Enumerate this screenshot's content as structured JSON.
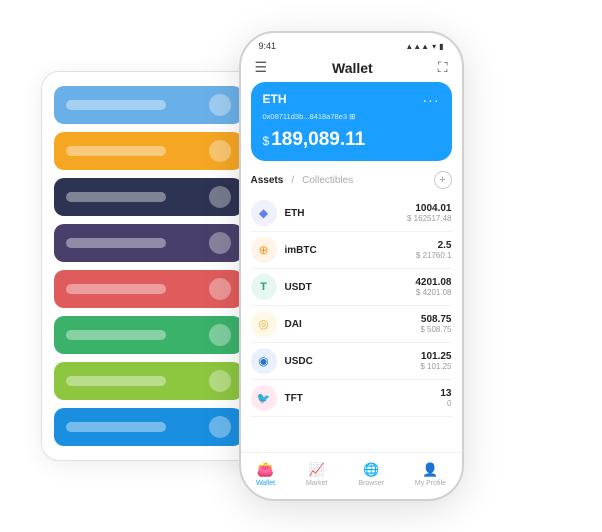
{
  "bg_card": {
    "rows": [
      {
        "color": "#6ab0e8",
        "text_opacity": 0.4
      },
      {
        "color": "#f5a623",
        "text_opacity": 0.4
      },
      {
        "color": "#2d3352",
        "text_opacity": 0.4
      },
      {
        "color": "#4a3f6b",
        "text_opacity": 0.4
      },
      {
        "color": "#e05c5c",
        "text_opacity": 0.4
      },
      {
        "color": "#3ab26a",
        "text_opacity": 0.4
      },
      {
        "color": "#8dc63f",
        "text_opacity": 0.4
      },
      {
        "color": "#1a8fe0",
        "text_opacity": 0.4
      }
    ]
  },
  "phone": {
    "status_bar": {
      "time": "9:41",
      "signal": "▲▲▲",
      "wifi": "WiFi",
      "battery": "🔋"
    },
    "header": {
      "menu_icon": "☰",
      "title": "Wallet",
      "expand_icon": "⛶"
    },
    "eth_card": {
      "label": "ETH",
      "dots": "···",
      "address": "0x08711d3b...8418a78e3  ⊞",
      "currency_symbol": "$",
      "amount": "189,089.11"
    },
    "assets_section": {
      "tab_active": "Assets",
      "separator": "/",
      "tab_inactive": "Collectibles",
      "add_icon": "+"
    },
    "assets": [
      {
        "name": "ETH",
        "icon": "◆",
        "icon_color": "#627EEA",
        "amount": "1004.01",
        "usd": "$ 162517.48"
      },
      {
        "name": "imBTC",
        "icon": "⊕",
        "icon_color": "#F7931A",
        "amount": "2.5",
        "usd": "$ 21760.1"
      },
      {
        "name": "USDT",
        "icon": "T",
        "icon_color": "#26A17B",
        "amount": "4201.08",
        "usd": "$ 4201.08"
      },
      {
        "name": "DAI",
        "icon": "◎",
        "icon_color": "#F5AC37",
        "amount": "508.75",
        "usd": "$ 508.75"
      },
      {
        "name": "USDC",
        "icon": "◉",
        "icon_color": "#2775CA",
        "amount": "101.25",
        "usd": "$ 101.25"
      },
      {
        "name": "TFT",
        "icon": "🐦",
        "icon_color": "#e85d9a",
        "amount": "13",
        "usd": "0"
      }
    ],
    "bottom_nav": [
      {
        "icon": "👛",
        "label": "Wallet",
        "active": true
      },
      {
        "icon": "📈",
        "label": "Market",
        "active": false
      },
      {
        "icon": "🌐",
        "label": "Browser",
        "active": false
      },
      {
        "icon": "👤",
        "label": "My Profile",
        "active": false
      }
    ]
  }
}
